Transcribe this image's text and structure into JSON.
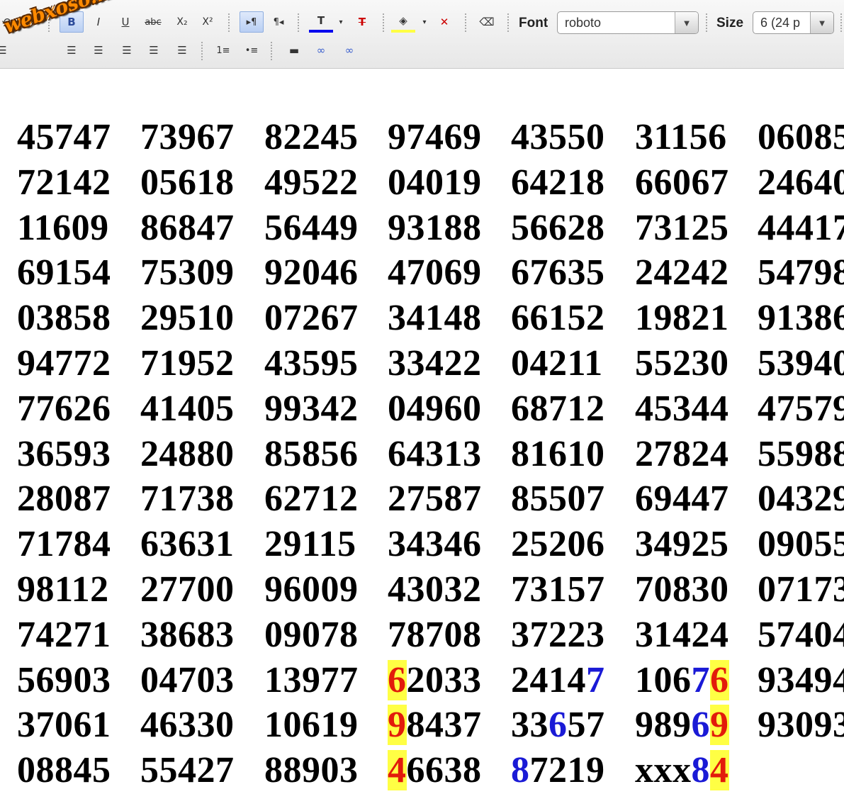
{
  "toolbar": {
    "watermark": "webxoso.net",
    "font_label": "Font",
    "font_value": "roboto",
    "size_label": "Size",
    "size_value": "6 (24 p",
    "buttons": {
      "undo": "↶",
      "redo": "↷",
      "bold": "B",
      "italic": "I",
      "underline": "U",
      "strikethrough": "abc",
      "subscript": "X₂",
      "superscript": "X²",
      "ltr": "▸¶",
      "rtl": "¶◂",
      "text_color": "T",
      "remove_format": "T",
      "bg_color": "◈",
      "clear_highlight": "✕",
      "eraser": "⌫",
      "align_left": "☰",
      "align_center": "☰",
      "align_right": "☰",
      "align_justify": "☰",
      "align_full": "☰",
      "ordered_list": "1≡",
      "unordered_list": "•≡",
      "hr": "▬",
      "link": "∞",
      "unlink": "∞"
    }
  },
  "colors": {
    "highlight_bg": "#ffff44",
    "red_digit": "#e21b0b",
    "blue_digit": "#1a1ad6"
  },
  "grid": {
    "rows": [
      [
        "45747",
        "73967",
        "82245",
        "97469",
        "43550",
        "31156",
        "06085"
      ],
      [
        "72142",
        "05618",
        "49522",
        "04019",
        "64218",
        "66067",
        "24640"
      ],
      [
        "11609",
        "86847",
        "56449",
        "93188",
        "56628",
        "73125",
        "44417"
      ],
      [
        "69154",
        "75309",
        "92046",
        "47069",
        "67635",
        "24242",
        "54798"
      ],
      [
        "03858",
        "29510",
        "07267",
        "34148",
        "66152",
        "19821",
        "91386"
      ],
      [
        "94772",
        "71952",
        "43595",
        "33422",
        "04211",
        "55230",
        "53940"
      ],
      [
        "77626",
        "41405",
        "99342",
        "04960",
        "68712",
        "45344",
        "47579"
      ],
      [
        "36593",
        "24880",
        "85856",
        "64313",
        "81610",
        "27824",
        "55988"
      ],
      [
        "28087",
        "71738",
        "62712",
        "27587",
        "85507",
        "69447",
        "04329"
      ],
      [
        "71784",
        "63631",
        "29115",
        "34346",
        "25206",
        "34925",
        "09055"
      ],
      [
        "98112",
        "27700",
        "96009",
        "43032",
        "73157",
        "70830",
        "07173"
      ],
      [
        "74271",
        "38683",
        "09078",
        "78708",
        "37223",
        "31424",
        "57404"
      ],
      [
        "56903",
        "04703",
        "13977",
        "62033",
        "24147",
        "10676",
        "93494"
      ],
      [
        "37061",
        "46330",
        "10619",
        "98437",
        "33657",
        "98969",
        "93093"
      ],
      [
        "08845",
        "55427",
        "88903",
        "46638",
        "87219",
        "xxx84",
        ""
      ]
    ]
  }
}
